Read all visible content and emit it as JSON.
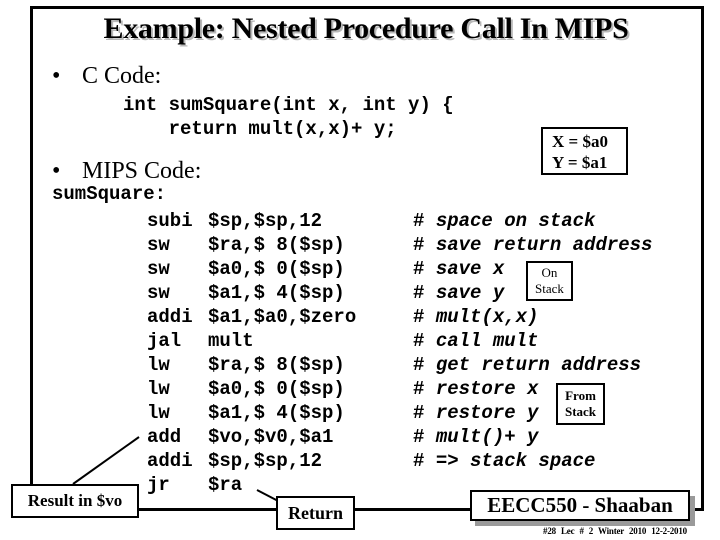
{
  "slide": {
    "title": "Example:  Nested Procedure Call In MIPS",
    "bullets": [
      {
        "icon": "bullet-dot",
        "label": "C Code:"
      },
      {
        "icon": "bullet-dot",
        "label": "MIPS Code:"
      }
    ],
    "bullet_glyph": "•"
  },
  "c_code": {
    "lines": [
      "int sumSquare(int x, int y) {",
      "    return mult(x,x)+ y;"
    ]
  },
  "register_note": {
    "lines": [
      "X = $a0",
      "Y = $a1"
    ]
  },
  "mips_code": {
    "label": "sumSquare:",
    "instructions": [
      {
        "op": "subi",
        "args": "$sp,$sp,12",
        "comment": "space on stack"
      },
      {
        "op": "sw",
        "args": "$ra,$ 8($sp)",
        "comment": "save return address"
      },
      {
        "op": "sw",
        "args": "$a0,$ 0($sp)",
        "comment": "save x"
      },
      {
        "op": "sw",
        "args": "$a1,$ 4($sp)",
        "comment": "save y"
      },
      {
        "op": "addi",
        "args": "$a1,$a0,$zero",
        "comment": "mult(x,x)"
      },
      {
        "op": "jal",
        "args": "mult",
        "comment": "call mult"
      },
      {
        "op": "lw",
        "args": "$ra,$ 8($sp)",
        "comment": "get return address"
      },
      {
        "op": "lw",
        "args": "$a0,$ 0($sp)",
        "comment": "restore x"
      },
      {
        "op": "lw",
        "args": "$a1,$ 4($sp)",
        "comment": "restore y"
      },
      {
        "op": "add",
        "args": "$vo,$v0,$a1",
        "comment": "mult()+ y"
      },
      {
        "op": "addi",
        "args": "$sp,$sp,12",
        "comment": "=> stack space"
      },
      {
        "op": "jr",
        "args": "$ra",
        "comment": ""
      }
    ],
    "comment_marker": "#"
  },
  "callouts": {
    "on_stack": [
      "On",
      "Stack"
    ],
    "from_stack": [
      "From",
      "Stack"
    ],
    "result": "Result in $vo",
    "return": "Return"
  },
  "footer": {
    "course": "EECC550 - Shaaban",
    "meta": "#28  Lec # 2  Winter 2010  12-2-2010"
  }
}
